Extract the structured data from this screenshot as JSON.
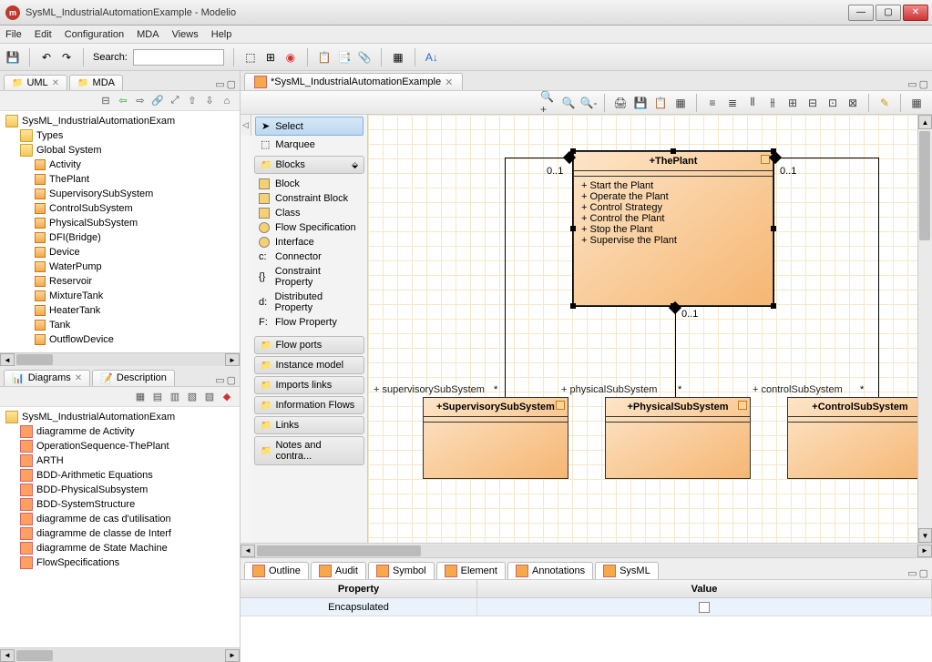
{
  "window": {
    "title": "SysML_IndustrialAutomationExample - Modelio"
  },
  "menu": {
    "file": "File",
    "edit": "Edit",
    "config": "Configuration",
    "mda": "MDA",
    "views": "Views",
    "help": "Help"
  },
  "toolbar": {
    "search_label": "Search:"
  },
  "left_tabs": {
    "uml": "UML",
    "mda": "MDA"
  },
  "tree_root": "SysML_IndustrialAutomationExam",
  "tree": {
    "types": "Types",
    "global": "Global System",
    "items": [
      "Activity",
      "ThePlant",
      "SupervisorySubSystem",
      "ControlSubSystem",
      "PhysicalSubSystem",
      "DFI(Bridge)",
      "Device",
      "WaterPump",
      "Reservoir",
      "MixtureTank",
      "HeaterTank",
      "Tank",
      "OutflowDevice"
    ]
  },
  "diagrams_tab": {
    "diagrams": "Diagrams",
    "description": "Description"
  },
  "diagrams_root": "SysML_IndustrialAutomationExam",
  "diagrams": [
    "diagramme de Activity",
    "OperationSequence-ThePlant",
    "ARTH",
    "BDD-Arithmetic Equations",
    "BDD-PhysicalSubsystem",
    "BDD-SystemStructure",
    "diagramme de cas d'utilisation",
    "diagramme de classe de Interf",
    "diagramme de State Machine",
    "FlowSpecifications"
  ],
  "editor_tab": "*SysML_IndustrialAutomationExample",
  "palette": {
    "select": "Select",
    "marquee": "Marquee",
    "blocks": "Blocks",
    "blocks_items": [
      "Block",
      "Constraint Block",
      "Class",
      "Flow Specification",
      "Interface",
      "Connector",
      "Constraint Property",
      "Distributed Property",
      "Flow Property"
    ],
    "flow_ports": "Flow ports",
    "instance": "Instance model",
    "imports": "Imports links",
    "info": "Information Flows",
    "links": "Links",
    "notes": "Notes and contra..."
  },
  "diagram": {
    "plant_title": "+ThePlant",
    "plant_ops": [
      "+ Start the Plant",
      "+ Operate the Plant",
      "+ Control Strategy",
      "+ Control the Plant",
      "+ Stop the Plant",
      "+ Supervise the Plant"
    ],
    "mult": "0..1",
    "star": "*",
    "sup_block": "+SupervisorySubSystem",
    "phy_block": "+PhysicalSubSystem",
    "ctl_block": "+ControlSubSystem",
    "sup_label": "+ supervisorySubSystem",
    "phy_label": "+ physicalSubSystem",
    "ctl_label": "+ controlSubSystem"
  },
  "bottom_tabs": {
    "outline": "Outline",
    "audit": "Audit",
    "symbol": "Symbol",
    "element": "Element",
    "annot": "Annotations",
    "sysml": "SysML"
  },
  "prop": {
    "property": "Property",
    "value": "Value",
    "enc": "Encapsulated"
  }
}
